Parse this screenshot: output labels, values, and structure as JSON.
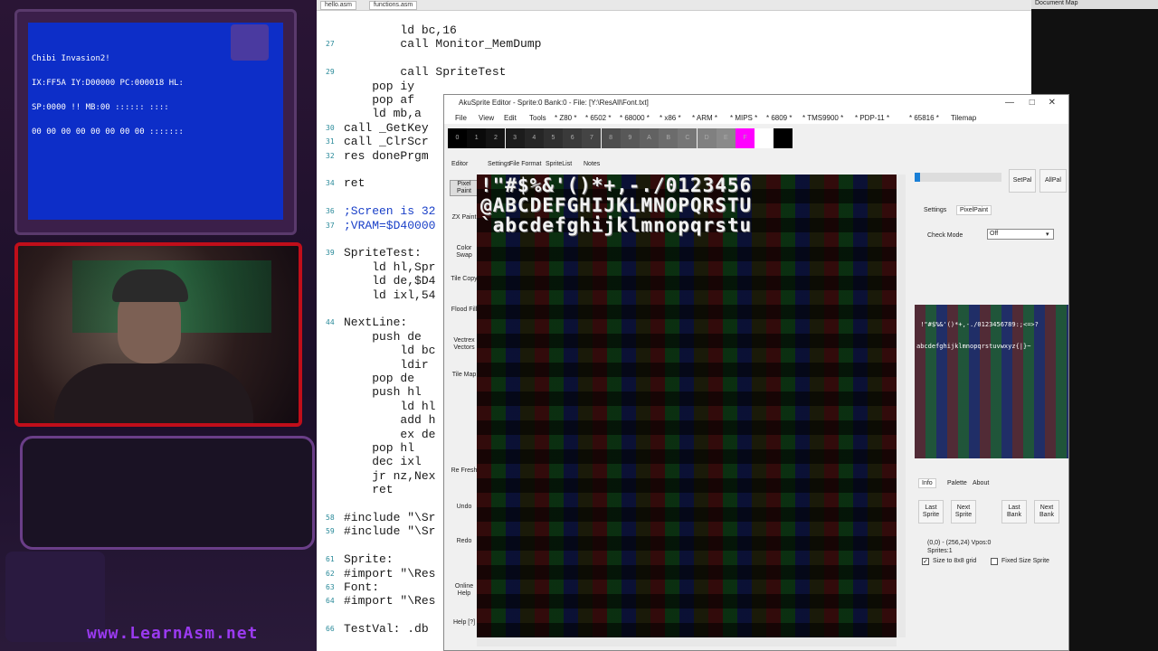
{
  "emulator": {
    "title": "Chibi Invasion2!",
    "lines": [
      "IX:FF5A IY:D00000 PC:000018 HL:",
      "SP:0000 !! MB:00 :::::: ::::",
      "00 00 00 00 00 00 00 00 :::::::"
    ]
  },
  "stream": {
    "site_url": "www.LearnAsm.net"
  },
  "editor": {
    "tabs": [
      "hello.asm",
      "functions.asm"
    ],
    "code_lines": [
      {
        "ln": "",
        "text": "        ld bc,16"
      },
      {
        "ln": "27",
        "text": "        call Monitor_MemDump"
      },
      {
        "ln": "",
        "text": ""
      },
      {
        "ln": "29",
        "text": "        call SpriteTest"
      },
      {
        "ln": "",
        "text": "    pop iy"
      },
      {
        "ln": "",
        "text": "    pop af"
      },
      {
        "ln": "",
        "text": "    ld mb,a"
      },
      {
        "ln": "30",
        "text": "call _GetKey"
      },
      {
        "ln": "31",
        "text": "call _ClrScr"
      },
      {
        "ln": "32",
        "text": "res donePrgm"
      },
      {
        "ln": "",
        "text": ""
      },
      {
        "ln": "34",
        "text": "ret"
      },
      {
        "ln": "",
        "text": ""
      },
      {
        "ln": "36",
        "text": ";Screen is 32"
      },
      {
        "ln": "37",
        "text": ";VRAM=$D40000"
      },
      {
        "ln": "",
        "text": ""
      },
      {
        "ln": "39",
        "text": "SpriteTest:"
      },
      {
        "ln": "",
        "text": "    ld hl,Spr"
      },
      {
        "ln": "",
        "text": "    ld de,$D4"
      },
      {
        "ln": "",
        "text": "    ld ixl,54"
      },
      {
        "ln": "",
        "text": ""
      },
      {
        "ln": "44",
        "text": "NextLine:"
      },
      {
        "ln": "",
        "text": "    push de"
      },
      {
        "ln": "",
        "text": "        ld bc"
      },
      {
        "ln": "",
        "text": "        ldir"
      },
      {
        "ln": "",
        "text": "    pop de"
      },
      {
        "ln": "",
        "text": "    push hl"
      },
      {
        "ln": "",
        "text": "        ld hl"
      },
      {
        "ln": "",
        "text": "        add h"
      },
      {
        "ln": "",
        "text": "        ex de"
      },
      {
        "ln": "",
        "text": "    pop hl"
      },
      {
        "ln": "",
        "text": "    dec ixl"
      },
      {
        "ln": "",
        "text": "    jr nz,Nex"
      },
      {
        "ln": "",
        "text": "    ret"
      },
      {
        "ln": "",
        "text": ""
      },
      {
        "ln": "58",
        "text": "#include \"\\Sr"
      },
      {
        "ln": "59",
        "text": "#include \"\\Sr"
      },
      {
        "ln": "",
        "text": ""
      },
      {
        "ln": "61",
        "text": "Sprite:"
      },
      {
        "ln": "62",
        "text": "#import \"\\Res"
      },
      {
        "ln": "63",
        "text": "Font:"
      },
      {
        "ln": "64",
        "text": "#import \"\\Res"
      },
      {
        "ln": "",
        "text": ""
      },
      {
        "ln": "66",
        "text": "TestVal: .db"
      }
    ]
  },
  "docmap": {
    "title": "Document Map"
  },
  "sprite_editor": {
    "title": "AkuSprite Editor - Sprite:0 Bank:0 - File: [Y:\\ResAll\\Font.txt]",
    "menu": [
      "File",
      "View",
      "Edit",
      "Tools",
      "* Z80 *",
      "* 6502 *",
      "* 68000 *",
      "* x86 *",
      "* ARM *",
      "* MIPS *",
      "* 6809 *",
      "* TMS9900 *",
      "* PDP-11 *",
      "* 65816 *",
      "Tilemap"
    ],
    "palette": [
      {
        "label": "0",
        "color": "#000000"
      },
      {
        "label": "1",
        "color": "#0a0a0a"
      },
      {
        "label": "2",
        "color": "#141414"
      },
      {
        "label": "3",
        "color": "#1c1c1c"
      },
      {
        "label": "4",
        "color": "#262626"
      },
      {
        "label": "5",
        "color": "#303030"
      },
      {
        "label": "6",
        "color": "#3a3a3a"
      },
      {
        "label": "7",
        "color": "#444444"
      },
      {
        "label": "8",
        "color": "#4e4e4e"
      },
      {
        "label": "9",
        "color": "#585858"
      },
      {
        "label": "A",
        "color": "#626262"
      },
      {
        "label": "B",
        "color": "#6c6c6c"
      },
      {
        "label": "C",
        "color": "#767676"
      },
      {
        "label": "D",
        "color": "#808080"
      },
      {
        "label": "E",
        "color": "#8a8a8a"
      },
      {
        "label": "F",
        "color": "#ff00ff"
      },
      {
        "label": "",
        "color": "#ffffff"
      },
      {
        "label": "",
        "color": "#000000"
      }
    ],
    "sub_tabs": [
      "Editor",
      "Settings",
      "File Format",
      "SpriteList",
      "Notes"
    ],
    "tools": [
      "Pixel Paint",
      "ZX Paint",
      "Color Swap",
      "Tile Copy",
      "Flood Fill",
      "Vectrex Vectors",
      "Tile Map",
      "Re Fresh",
      "Undo",
      "Redo",
      "Online Help",
      "Help [?]"
    ],
    "glyph_rows": [
      "!\"#$%&'()*+,-./0123456",
      "@ABCDEFGHIJKLMNOPQRSTU",
      "`abcdefghijklmnopqrstu"
    ],
    "right_panel": {
      "setpal": "SetPal",
      "allpal": "AllPal",
      "tabs": [
        "Settings",
        "PixelPaint"
      ],
      "check_mode_label": "Check Mode",
      "check_mode_value": "Off",
      "preview_text": [
        " !\"#$%&'()*+,-./0123456789:;<=>?",
        "abcdefghijklmnopqrstuvwxyz{|}~"
      ],
      "info_tabs": [
        "Info",
        "Palette",
        "About"
      ],
      "nav_buttons": [
        "Last Sprite",
        "Next Sprite",
        "Last Bank",
        "Next Bank"
      ],
      "coords": "(0,0) - (256,24)   Vpos:0",
      "sprites": "Sprites:1",
      "size_8x8": "Size to 8x8 grid",
      "fixed_size": "Fixed Size Sprite"
    }
  }
}
